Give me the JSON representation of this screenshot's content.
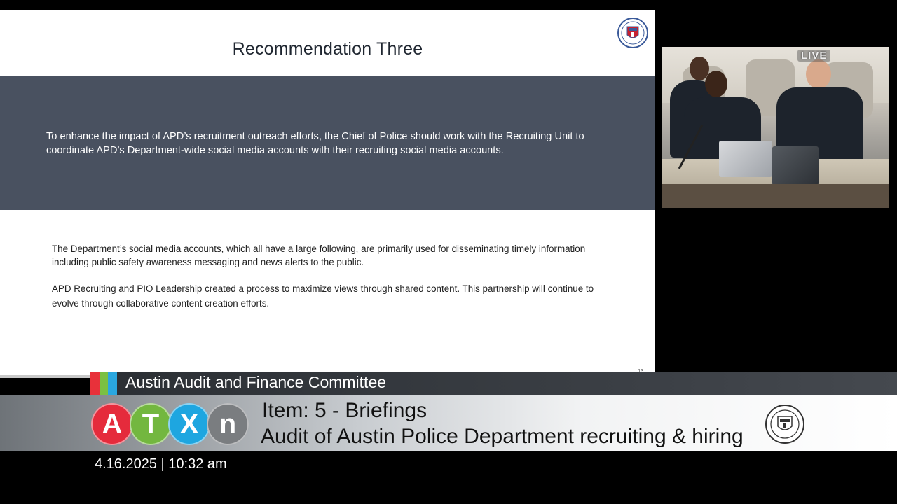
{
  "slide": {
    "title": "Recommendation Three",
    "recommendation_text": "To enhance the impact of APD’s recruitment outreach efforts, the Chief of Police should work with the Recruiting Unit to coordinate APD’s Department-wide social media accounts with their recruiting social media accounts.",
    "paragraph_1": "The Department’s social media accounts, which all have a large following, are primarily used for disseminating timely information including public safety awareness messaging and news alerts to the public.",
    "paragraph_2": "APD Recruiting and PIO Leadership created a process to maximize views through shared content. This partnership will continue to evolve through collaborative content creation efforts.",
    "page_number": "13",
    "seal_icon": "city-of-austin-seal-icon",
    "band_color": "#495160"
  },
  "camera": {
    "live_label": "LIVE"
  },
  "lower_third": {
    "committee": "Austin Audit and Finance Committee",
    "color_tabs": [
      "#e8313a",
      "#7bc043",
      "#2aa7df"
    ],
    "logo_letters": [
      {
        "letter": "A",
        "color": "#e52b3c"
      },
      {
        "letter": "T",
        "color": "#73b73f"
      },
      {
        "letter": "X",
        "color": "#1ea6e0"
      },
      {
        "letter": "n",
        "color": "#7a7d80"
      }
    ],
    "item": "Item: 5 - Briefings",
    "subtitle": "Audit of Austin Police Department recruiting & hiring",
    "datetime": "4.16.2025 | 10:32 am"
  }
}
